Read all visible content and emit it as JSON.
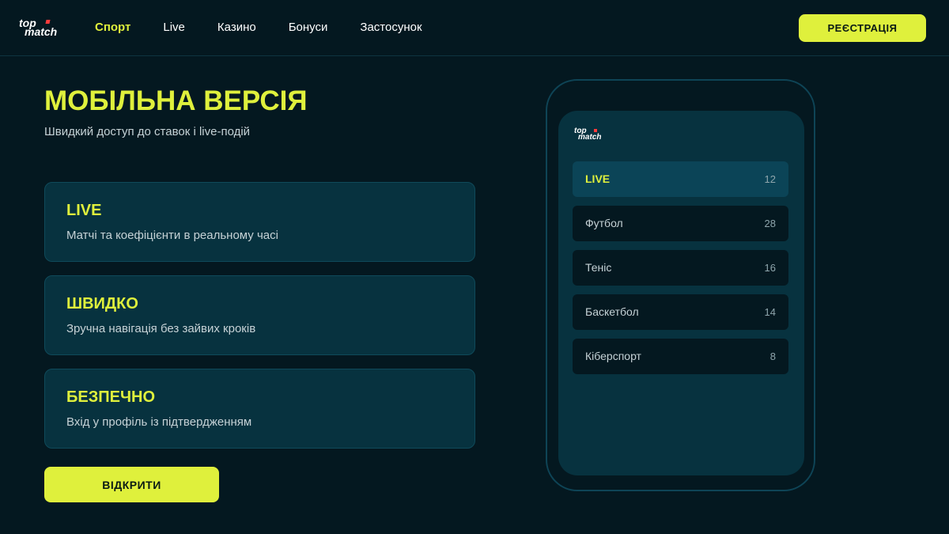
{
  "brand": {
    "logo_line1": "top",
    "logo_line2": "match"
  },
  "nav": [
    {
      "label": "Спорт",
      "active": true
    },
    {
      "label": "Live",
      "active": false
    },
    {
      "label": "Казино",
      "active": false
    },
    {
      "label": "Бонуси",
      "active": false
    },
    {
      "label": "Застосунок",
      "active": false
    }
  ],
  "header": {
    "register_label": "РЕЄСТРАЦІЯ"
  },
  "hero": {
    "title": "МОБІЛЬНА ВЕРСІЯ",
    "subtitle": "Швидкий доступ до ставок і live-подій"
  },
  "features": [
    {
      "title": "LIVE",
      "description": "Матчі та коефіцієнти в реальному часі"
    },
    {
      "title": "ШВИДКО",
      "description": "Зручна навігація без зайвих кроків"
    },
    {
      "title": "БЕЗПЕЧНО",
      "description": "Вхід у профіль із підтвердженням"
    }
  ],
  "cta": {
    "open_label": "ВІДКРИТИ"
  },
  "phone": {
    "logo_line1": "top",
    "logo_line2": "match",
    "sports": [
      {
        "name": "LIVE",
        "count": "12"
      },
      {
        "name": "Футбол",
        "count": "28"
      },
      {
        "name": "Теніс",
        "count": "16"
      },
      {
        "name": "Баскетбол",
        "count": "14"
      },
      {
        "name": "Кіберспорт",
        "count": "8"
      }
    ]
  },
  "colors": {
    "background": "#041820",
    "card": "#07323f",
    "accent": "#dff03c",
    "logo_dot": "#ff3b3b"
  }
}
